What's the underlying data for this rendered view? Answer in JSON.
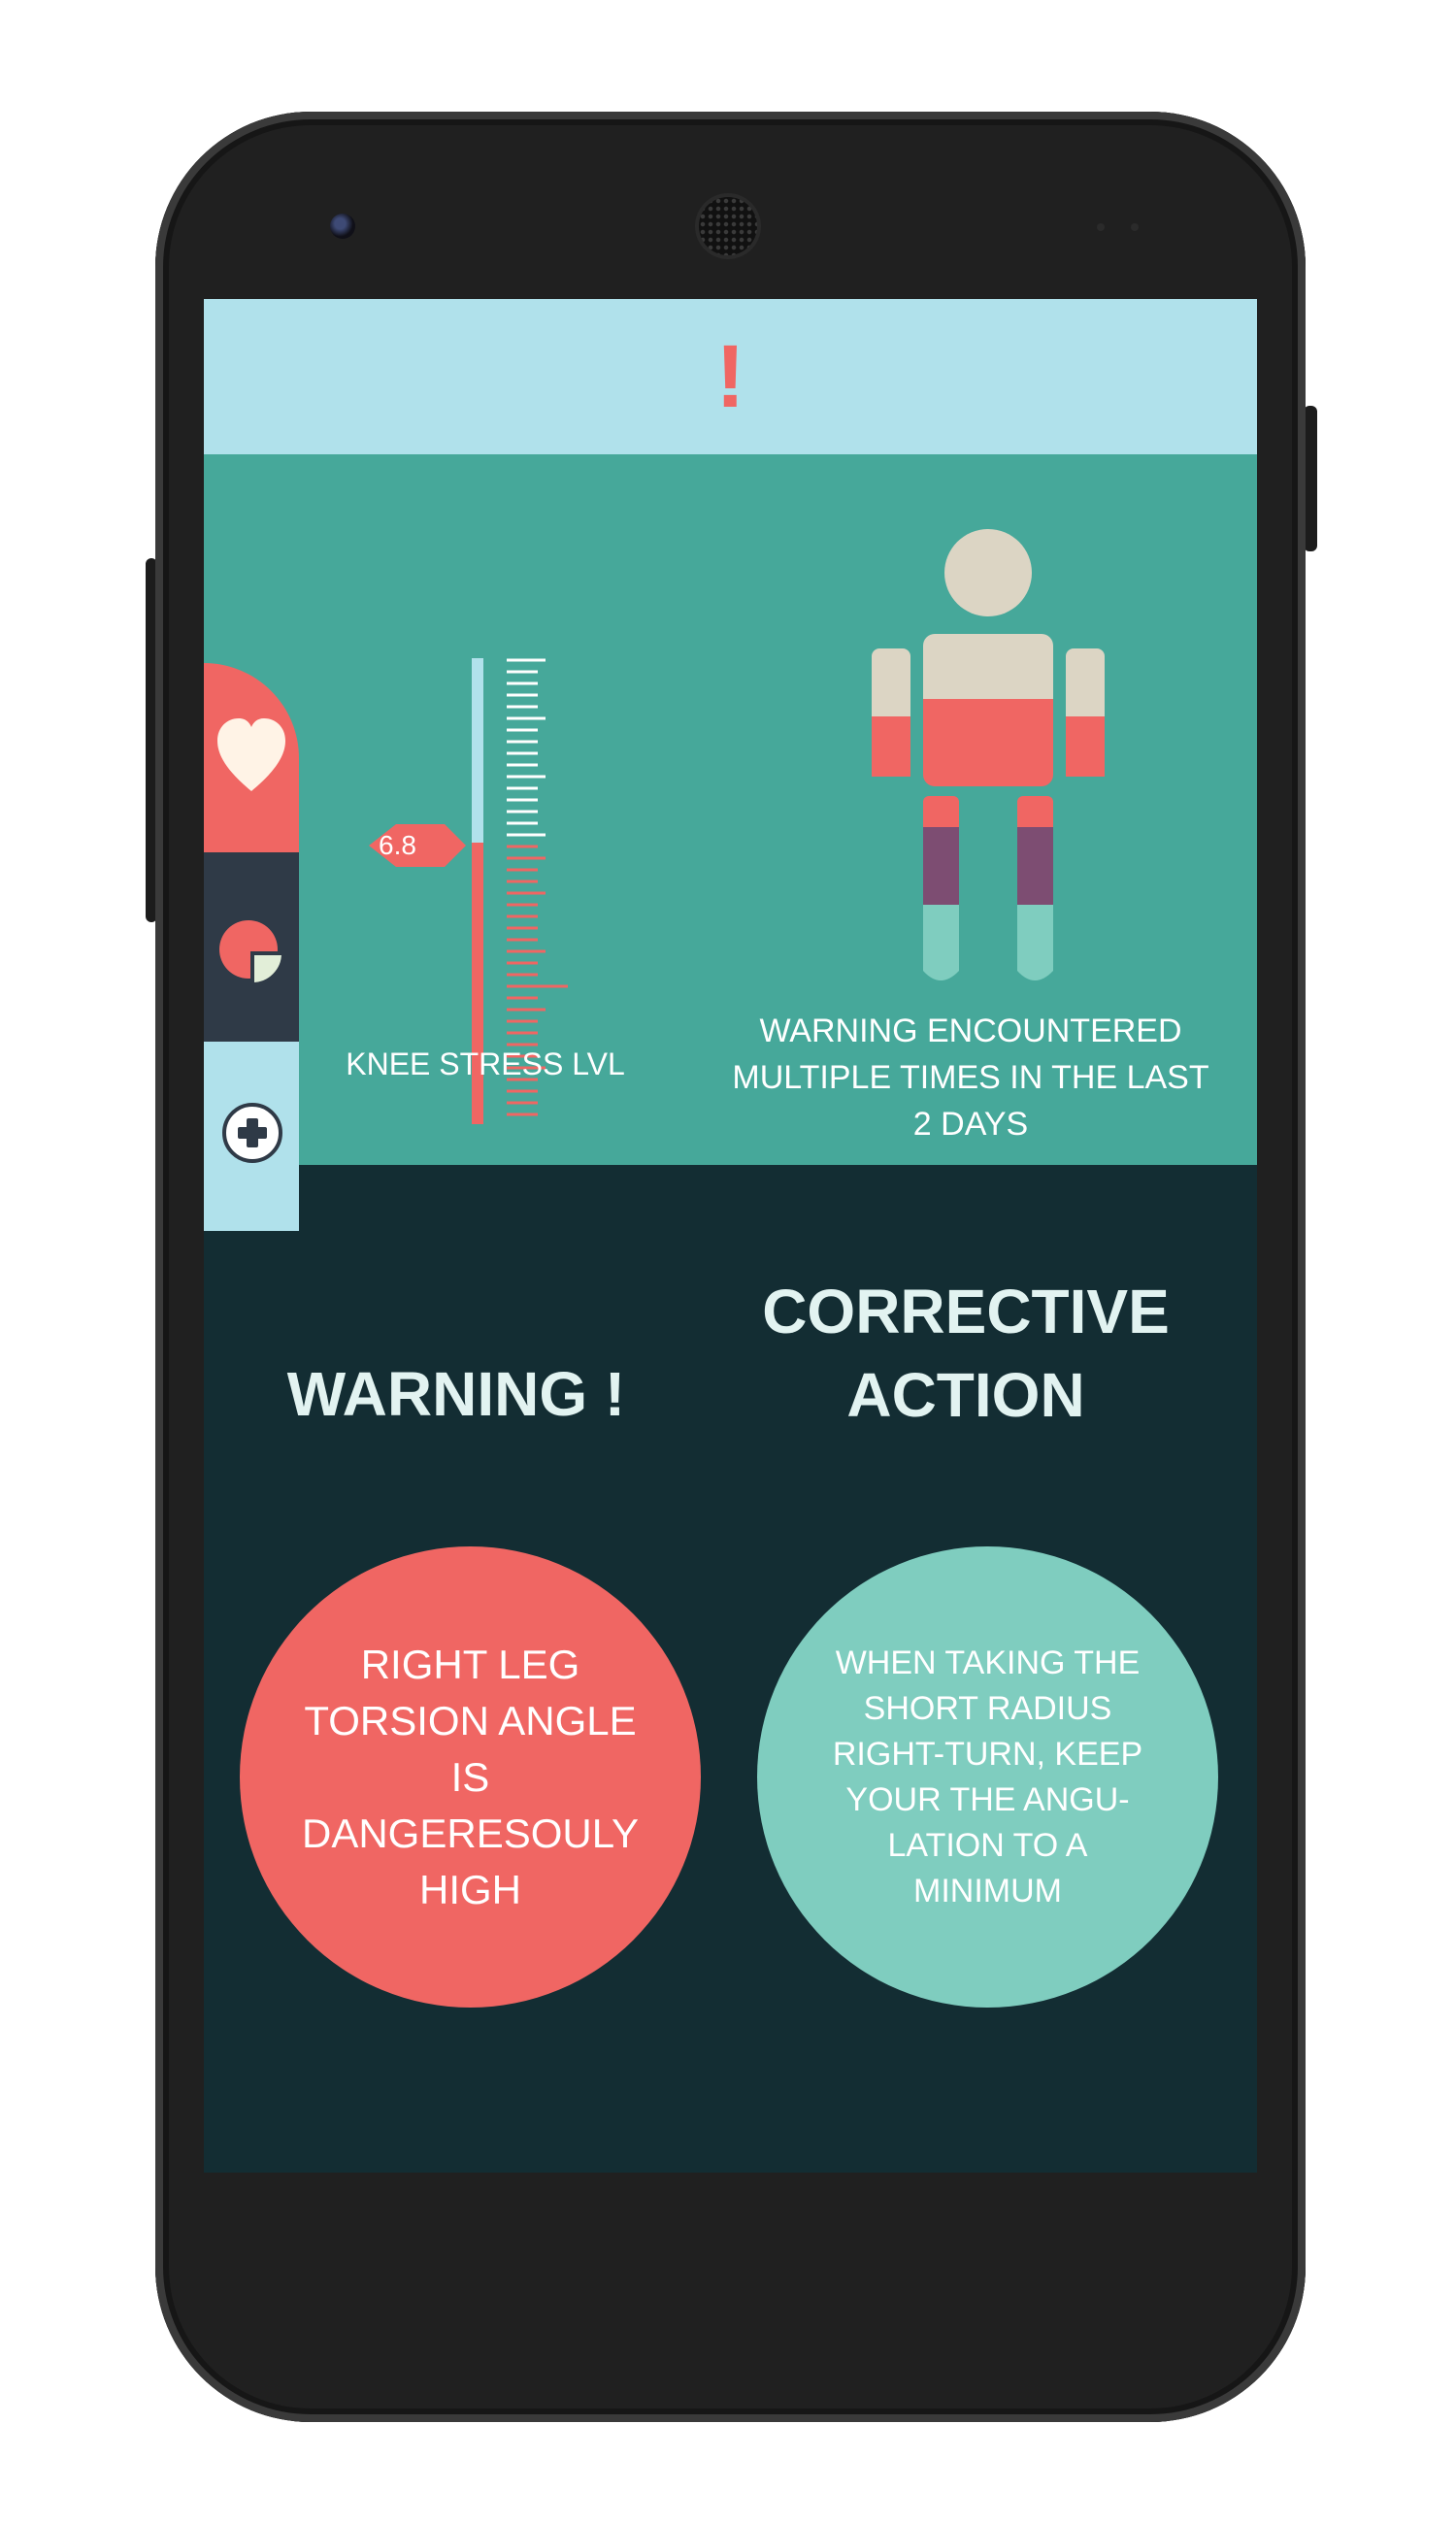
{
  "header": {
    "alert_symbol": "!"
  },
  "sidebar": {
    "items": [
      {
        "name": "health",
        "icon": "heart-icon"
      },
      {
        "name": "stats",
        "icon": "pie-chart-icon"
      },
      {
        "name": "add",
        "icon": "plus-circle-icon"
      }
    ]
  },
  "gauge": {
    "label": "KNEE STRESS LVL",
    "value_label": "6.8",
    "value": 6.8
  },
  "body_figure": {
    "warning_text": "WARNING ENCOUNTERED MULTIPLE TIMES IN THE LAST 2 DAYS"
  },
  "warning": {
    "title": "WARNING !",
    "message": "RIGHT LEG\nTORSION ANGLE\nIS\nDANGERESOULY\nHIGH"
  },
  "corrective": {
    "title": "CORRECTIVE ACTION",
    "message": "WHEN TAKING THE\nSHORT RADIUS\nRIGHT-TURN, KEEP\nYOUR THE ANGU-\nLATION TO A\nMINIMUM"
  },
  "colors": {
    "coral": "#f06663",
    "teal": "#46a89a",
    "light_blue": "#b0e1eb",
    "dark_bg": "#132d33",
    "mint": "#7fcdbf",
    "beige": "#dcd5c4",
    "purple": "#7d4d72",
    "slate": "#2f3a47"
  }
}
